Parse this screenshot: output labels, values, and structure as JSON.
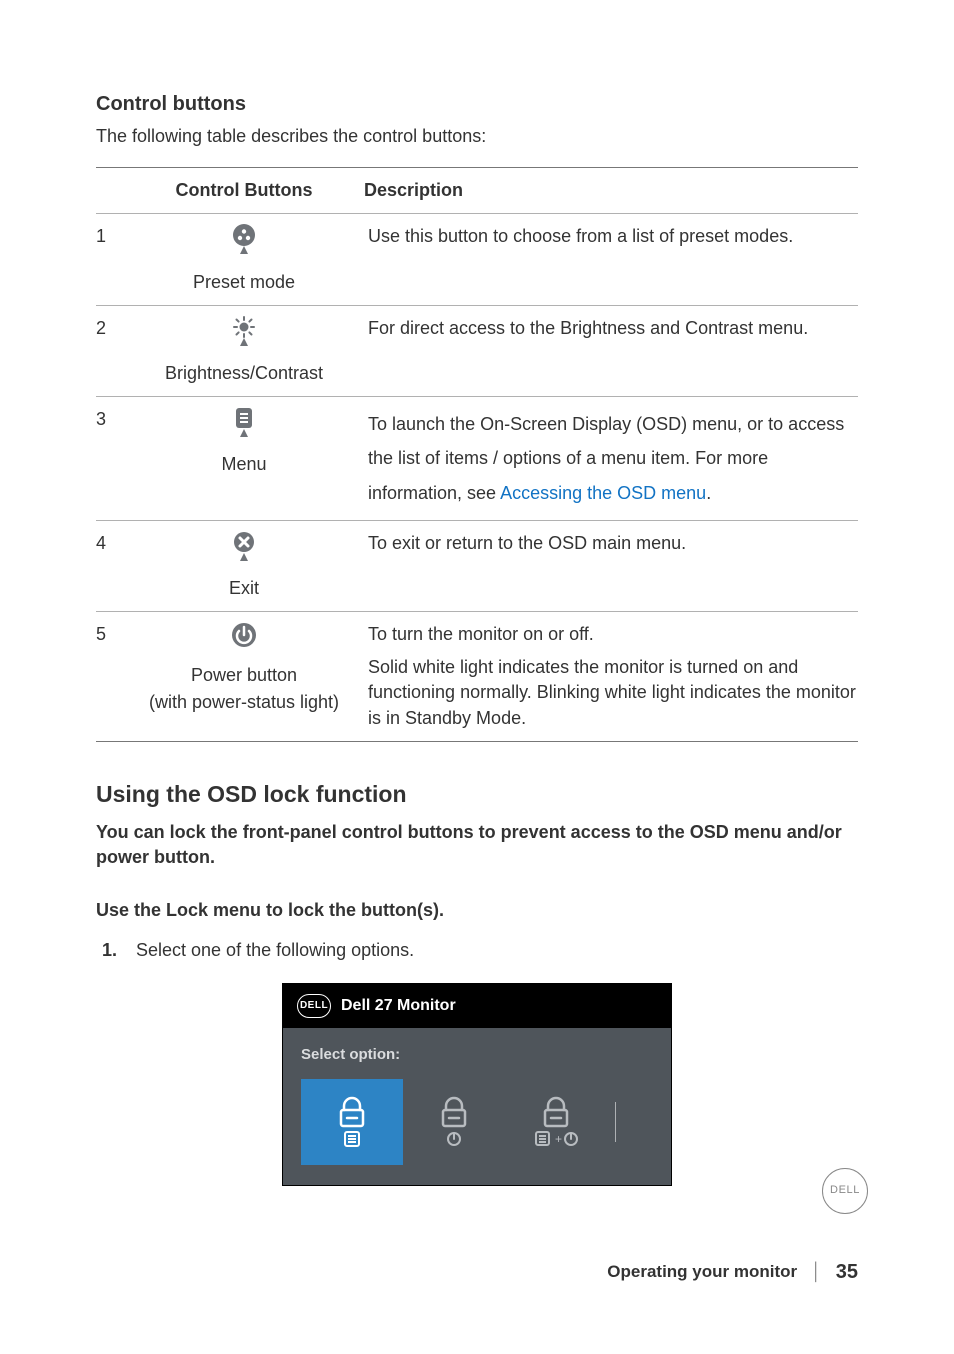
{
  "heading_control_buttons": "Control buttons",
  "intro_line": "The following table describes the control buttons:",
  "table": {
    "header_buttons": "Control Buttons",
    "header_description": "Description",
    "rows": [
      {
        "num": "1",
        "label": "Preset mode",
        "icon": "preset-mode-icon",
        "desc": "Use this button to choose from a list of preset modes."
      },
      {
        "num": "2",
        "label": "Brightness/Contrast",
        "icon": "brightness-icon",
        "desc": "For direct access to the Brightness and Contrast menu."
      },
      {
        "num": "3",
        "label": "Menu",
        "icon": "menu-icon",
        "desc_pre": "To launch the On-Screen Display (OSD) menu, or to access the list of items / options of a menu item. For more information, see ",
        "link_text": "Accessing the OSD menu",
        "desc_post": "."
      },
      {
        "num": "4",
        "label": "Exit",
        "icon": "exit-icon",
        "desc": "To exit or return to the OSD main menu."
      },
      {
        "num": "5",
        "label_line1": "Power button",
        "label_line2": "(with power-status light)",
        "icon": "power-icon",
        "desc_line1": "To turn the monitor on or off.",
        "desc_line2": "Solid white light indicates the monitor is turned on and functioning normally. Blinking white light indicates the monitor is in Standby Mode."
      }
    ]
  },
  "osd_heading": "Using the OSD lock function",
  "osd_bold_para": "You can lock the front-panel control buttons to prevent access to the OSD menu and/or power button.",
  "osd_sub_bold": "Use the Lock menu to lock the button(s).",
  "step1_marker": "1.",
  "step1_text": "Select one of the following options.",
  "osd_panel": {
    "title": "Dell 27 Monitor",
    "prompt": "Select option:",
    "options": [
      {
        "name": "lock-menu-option",
        "icon": "lock-menu-icon",
        "selected": true
      },
      {
        "name": "lock-power-option",
        "icon": "lock-power-icon",
        "selected": false
      },
      {
        "name": "lock-menu-plus-power-option",
        "icon": "lock-menu-power-icon",
        "selected": false
      }
    ]
  },
  "brand": "DELL",
  "footer": {
    "section": "Operating your monitor",
    "separator": "│",
    "page": "35"
  }
}
